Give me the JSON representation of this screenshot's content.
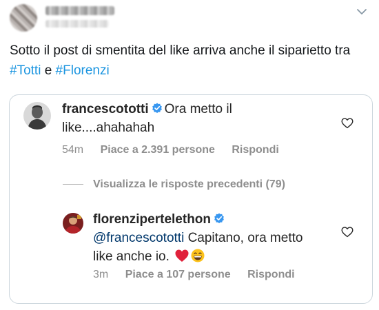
{
  "tweet": {
    "text_before": "Sotto il post di smentita del like arriva anche il siparietto tra ",
    "hashtag1": "#Totti",
    "text_middle": " e ",
    "hashtag2": "#Florenzi",
    "link_color": "#1b95e0"
  },
  "embed": {
    "comment1": {
      "username": "francescototti",
      "text": "Ora metto il like....ahahahah",
      "time": "54m",
      "likes": "Piace a 2.391 persone",
      "reply": "Rispondi"
    },
    "view_replies": "Visualizza le risposte precedenti (79)",
    "comment2": {
      "username": "florenzipertelethon",
      "mention": "@francescototti",
      "text": " Capitano, ora metto like anche io.",
      "time": "3m",
      "likes": "Piace a 107 persone",
      "reply": "Rispondi",
      "emojis": [
        "red-heart",
        "grinning-face"
      ]
    },
    "verified_color": "#3897f0"
  },
  "icons": [
    "chevron-down-icon",
    "verified-badge-icon",
    "heart-outline-icon",
    "red-heart-emoji",
    "grinning-face-emoji"
  ]
}
